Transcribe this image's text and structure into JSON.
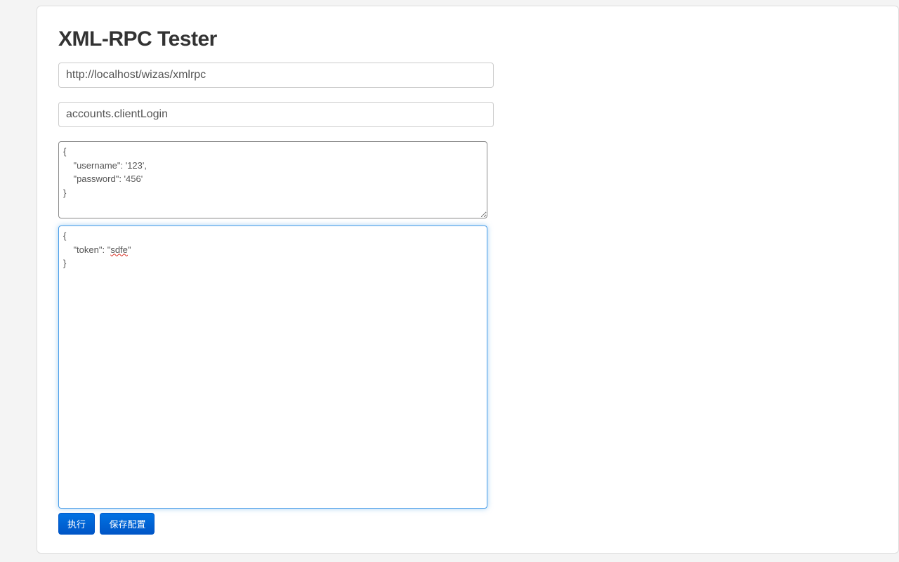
{
  "title": "XML-RPC Tester",
  "endpoint": {
    "value": "http://localhost/wizas/xmlrpc",
    "placeholder": ""
  },
  "method": {
    "value": "accounts.clientLogin",
    "placeholder": ""
  },
  "params": {
    "value": "{\n    \"username\": '123',\n    \"password\": '456'\n}"
  },
  "result": {
    "prefix": "{\n    \"token\": \"",
    "spell_word": "sdfe",
    "suffix": "\"\n}"
  },
  "buttons": {
    "execute": "执行",
    "save_config": "保存配置"
  }
}
